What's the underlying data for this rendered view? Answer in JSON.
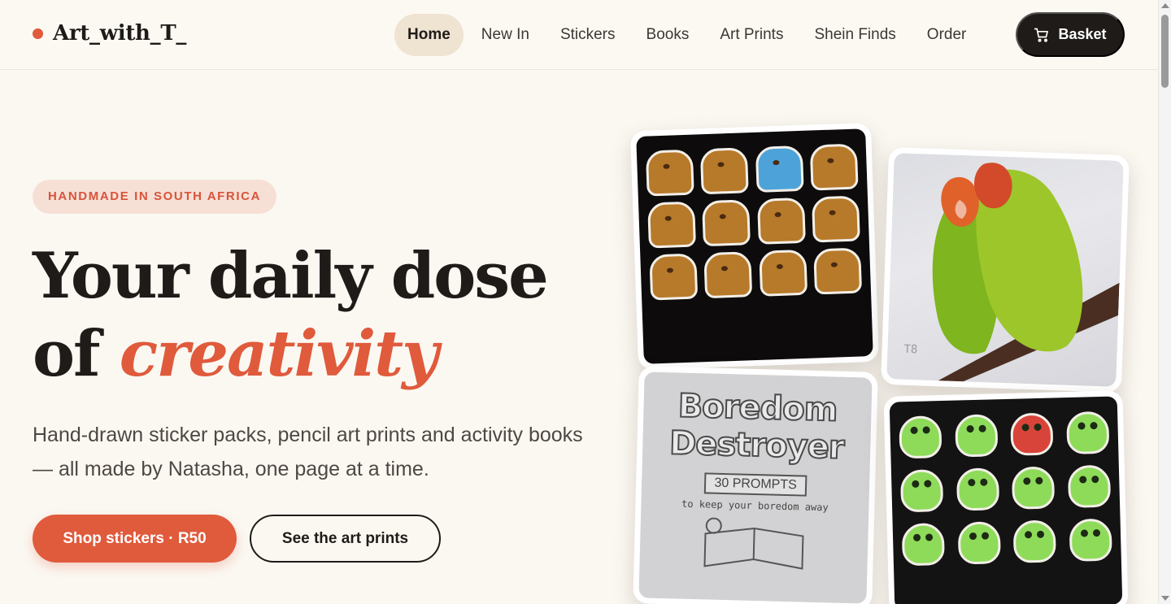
{
  "brand": {
    "name": "Art_with_T_",
    "dot_color": "#e05a3c"
  },
  "nav": {
    "items": [
      {
        "label": "Home",
        "active": true
      },
      {
        "label": "New In",
        "active": false
      },
      {
        "label": "Stickers",
        "active": false
      },
      {
        "label": "Books",
        "active": false
      },
      {
        "label": "Art Prints",
        "active": false
      },
      {
        "label": "Shein Finds",
        "active": false
      },
      {
        "label": "Order",
        "active": false
      }
    ],
    "basket_label": "Basket",
    "basket_icon": "cart-icon"
  },
  "hero": {
    "badge": "HANDMADE IN SOUTH AFRICA",
    "headline_line1": "Your daily dose",
    "headline_line2_prefix": "of ",
    "headline_accent": "creativity",
    "subtext": "Hand-drawn sticker packs, pencil art prints and activity books — all made by Natasha, one page at a time.",
    "primary_cta": "Shop stickers · R50",
    "secondary_cta": "See the art prints"
  },
  "gallery": {
    "book_cover": {
      "title_line1": "Boredom",
      "title_line2": "Destroyer",
      "ribbon": "30 PROMPTS",
      "subtitle": "to keep your boredom away"
    }
  },
  "colors": {
    "accent": "#e05a3c",
    "dark": "#1f1b19",
    "highlight": "#f7d98e",
    "background": "#fbf8f2"
  }
}
